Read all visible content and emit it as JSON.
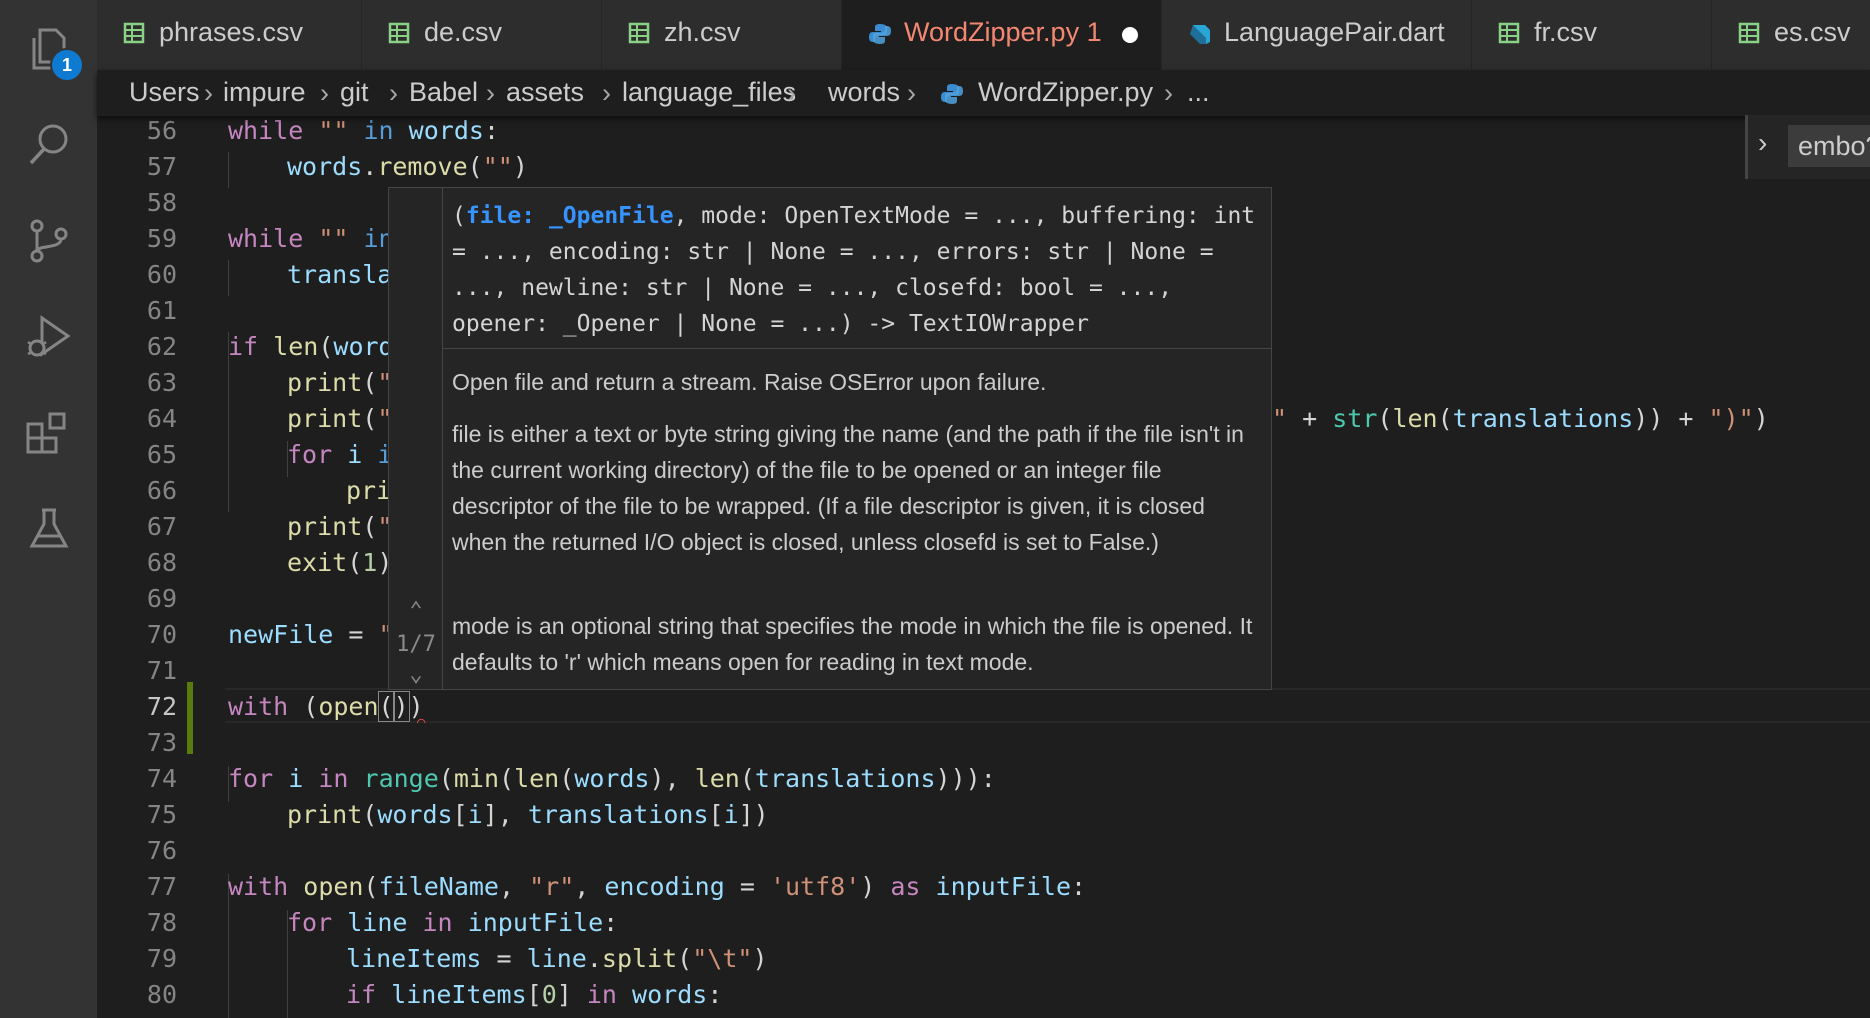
{
  "activity_bar": {
    "explorer_badge": "1",
    "items": [
      "explorer",
      "search",
      "source-control",
      "run-and-debug",
      "extensions",
      "testing"
    ]
  },
  "tabs": [
    {
      "label": "phrases.csv",
      "icon": "csv-table-icon"
    },
    {
      "label": "de.csv",
      "icon": "csv-table-icon"
    },
    {
      "label": "zh.csv",
      "icon": "csv-table-icon"
    },
    {
      "label": "WordZipper.py 1",
      "icon": "python-icon",
      "active": true,
      "dirty": true
    },
    {
      "label": "LanguagePair.dart",
      "icon": "dart-icon"
    },
    {
      "label": "fr.csv",
      "icon": "csv-table-icon"
    },
    {
      "label": "es.csv",
      "icon": "csv-table-icon"
    }
  ],
  "breadcrumbs": [
    "Users",
    "impure",
    "git",
    "Babel",
    "assets",
    "language_files",
    "words",
    "WordZipper.py",
    "..."
  ],
  "line_numbers": [
    "56",
    "57",
    "58",
    "59",
    "60",
    "61",
    "62",
    "63",
    "64",
    "65",
    "66",
    "67",
    "68",
    "69",
    "70",
    "71",
    "72",
    "73",
    "74",
    "75",
    "76",
    "77",
    "78",
    "79",
    "80"
  ],
  "code": {
    "l56": {
      "k1": "while",
      "s1": "\"\"",
      "k2": "in",
      "v1": "words",
      "p1": ":"
    },
    "l57": {
      "v1": "words",
      "p1": ".",
      "f1": "remove",
      "p2": "(",
      "s1": "\"\"",
      "p3": ")"
    },
    "l59": {
      "k1": "while",
      "s1": "\"\"",
      "k2": "in"
    },
    "l60": {
      "v1": "transla"
    },
    "l62": {
      "k1": "if",
      "f1": "len",
      "p1": "(",
      "v1": "word"
    },
    "l63": {
      "f1": "print",
      "p1": "(",
      "s1": "\""
    },
    "l64": {
      "f1": "print",
      "p1": "(",
      "s1": "\"",
      "s2": "\"",
      "p2": " + ",
      "b1": "str",
      "p3": "(",
      "f2": "len",
      "p4": "(",
      "v1": "translations",
      "p5": ")) + ",
      "s3": "\")\"",
      "p6": ")"
    },
    "l65": {
      "k1": "for",
      "v1": "i",
      "k2": "i"
    },
    "l66": {
      "f1": "pri"
    },
    "l67": {
      "f1": "print",
      "p1": "(",
      "s1": "\""
    },
    "l68": {
      "f1": "exit",
      "p1": "(",
      "n1": "1",
      "p2": ")"
    },
    "l70": {
      "v1": "newFile",
      "p1": " = ",
      "s1": "\""
    },
    "l72": {
      "k1": "with",
      "p1": " (",
      "f1": "open",
      "p2": "(",
      "p3": ")",
      "p4": ")"
    },
    "l74": {
      "k1": "for",
      "v1": "i",
      "k2": "in",
      "b1": "range",
      "p1": "(",
      "f1": "min",
      "p2": "(",
      "f2": "len",
      "p3": "(",
      "v2": "words",
      "p4": "), ",
      "f3": "len",
      "p5": "(",
      "v3": "translations",
      "p6": "))):"
    },
    "l75": {
      "f1": "print",
      "p1": "(",
      "v1": "words",
      "p2": "[",
      "v2": "i",
      "p3": "], ",
      "v3": "translations",
      "p4": "[",
      "v4": "i",
      "p5": "])"
    },
    "l77": {
      "k1": "with",
      "f1": "open",
      "p1": "(",
      "v1": "fileName",
      "p2": ", ",
      "s1": "\"r\"",
      "p3": ", ",
      "v2": "encoding",
      "p4": " = ",
      "s2": "'utf8'",
      "p5": ") ",
      "k2": "as",
      "v3": "inputFile",
      "p6": ":"
    },
    "l78": {
      "k1": "for",
      "v1": "line",
      "k2": "in",
      "v2": "inputFile",
      "p1": ":"
    },
    "l79": {
      "v1": "lineItems",
      "p1": " = ",
      "v2": "line",
      "p2": ".",
      "f1": "split",
      "p3": "(",
      "s1": "\"\\t\"",
      "p4": ")"
    },
    "l80": {
      "k1": "if",
      "v1": "lineItems",
      "p1": "[",
      "n1": "0",
      "p2": "] ",
      "k2": "in",
      "v2": "words",
      "p3": ":"
    }
  },
  "hover": {
    "sig_open": "(",
    "sig_active": "file: _OpenFile",
    "sig_rest": ", mode: OpenTextMode = ..., buffering: int = ..., encoding: str | None = ..., errors: str | None = ..., newline: str | None = ..., closefd: bool = ..., opener: _Opener | None = ...) -> TextIOWrapper",
    "overload": "1/7",
    "doc1": "Open file and return a stream. Raise OSError upon failure.",
    "doc2": "file is either a text or byte string giving the name (and the path if the file isn't in the current working directory) of the file to be opened or an integer file descriptor of the file to be wrapped. (If a file descriptor is given, it is closed when the returned I/O object is closed, unless closefd is set to False.)",
    "doc3": "mode is an optional string that specifies the mode in which the file is opened. It defaults to 'r' which means open for reading in text mode."
  },
  "peek": {
    "label": "embo?"
  },
  "colors": {
    "active_tab_text": "#f48771",
    "badge": "#0e7ad1",
    "signature_param": "#3794ff",
    "modified_gutter": "#587c0c"
  }
}
